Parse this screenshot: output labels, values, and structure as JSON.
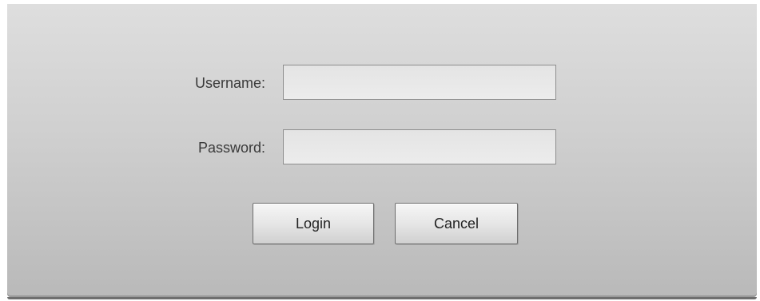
{
  "login_form": {
    "username_label": "Username:",
    "username_value": "",
    "password_label": "Password:",
    "password_value": "",
    "login_button": "Login",
    "cancel_button": "Cancel"
  }
}
